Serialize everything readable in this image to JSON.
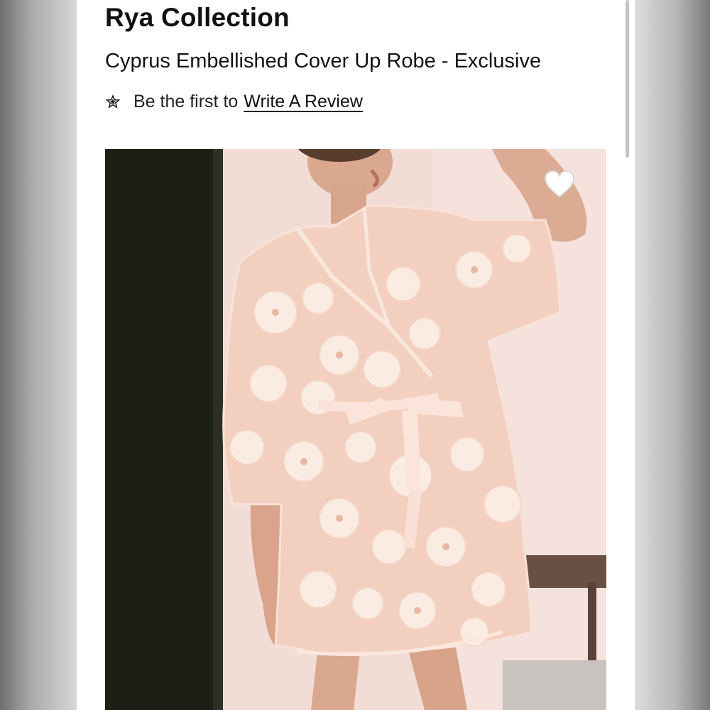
{
  "product": {
    "brand": "Rya Collection",
    "title": "Cyprus Embellished Cover Up Robe - Exclusive",
    "review_prefix": "Be the first to",
    "review_link": "Write A Review"
  },
  "icons": {
    "review": "star-icon",
    "favorite": "heart-icon"
  },
  "colors": {
    "page_bg": "#ffffff",
    "text": "#111111",
    "robe": "#f4d2c3",
    "wall": "#f1d9d4"
  }
}
